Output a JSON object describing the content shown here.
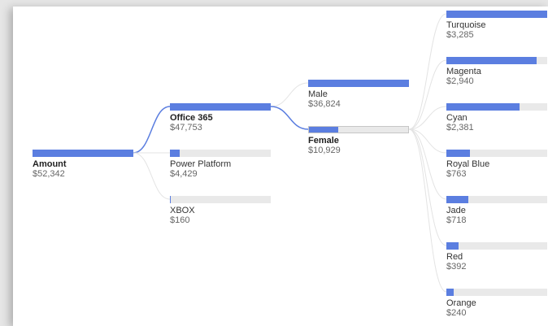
{
  "colors": {
    "bar": "#5b7ee0",
    "track": "#e9e9e9",
    "active_link": "#5b7ee0",
    "inactive_link": "#e3e3e3"
  },
  "tree": {
    "root": {
      "label": "Amount",
      "value": "$52,342",
      "fraction": 1.0
    },
    "level1": [
      {
        "label": "Office 365",
        "value": "$47,753",
        "fraction": 1.0,
        "active": true
      },
      {
        "label": "Power Platform",
        "value": "$4,429",
        "fraction": 0.093,
        "active": false
      },
      {
        "label": "XBOX",
        "value": "$160",
        "fraction": 0.004,
        "active": false
      }
    ],
    "level2": [
      {
        "label": "Male",
        "value": "$36,824",
        "fraction": 1.0,
        "active": false
      },
      {
        "label": "Female",
        "value": "$10,929",
        "fraction": 0.297,
        "active": true
      }
    ],
    "level3": [
      {
        "label": "Turquoise",
        "value": "$3,285",
        "fraction": 1.0
      },
      {
        "label": "Magenta",
        "value": "$2,940",
        "fraction": 0.895
      },
      {
        "label": "Cyan",
        "value": "$2,381",
        "fraction": 0.725
      },
      {
        "label": "Royal Blue",
        "value": "$763",
        "fraction": 0.232
      },
      {
        "label": "Jade",
        "value": "$718",
        "fraction": 0.219
      },
      {
        "label": "Red",
        "value": "$392",
        "fraction": 0.119
      },
      {
        "label": "Orange",
        "value": "$240",
        "fraction": 0.073
      }
    ]
  }
}
